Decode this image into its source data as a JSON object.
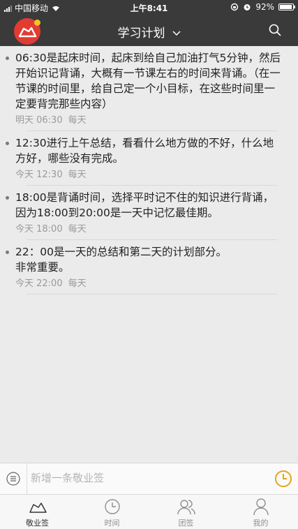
{
  "status_bar": {
    "carrier": "中国移动",
    "time": "上午8:41",
    "battery": "92%",
    "battery_level": 0.92
  },
  "header": {
    "title": "学习计划"
  },
  "plans": [
    {
      "text": "06:30是起床时间，起床到给自己加油打气5分钟，然后开始识记背诵，大概有一节课左右的时间来背诵。（在一节课的时间里，给自己定一个小目标，在这些时间里一定要背完那些内容）",
      "when": "明天 06:30",
      "repeat": "每天"
    },
    {
      "text": "12:30进行上午总结，看看什么地方做的不好，什么地方好，哪些没有完成。",
      "when": "今天 12:30",
      "repeat": "每天"
    },
    {
      "text": "18:00是背诵时间，选择平时记不住的知识进行背诵，因为18:00到20:00是一天中记忆最佳期。",
      "when": "今天 18:00",
      "repeat": "每天"
    },
    {
      "text": "22：00是一天的总结和第二天的计划部分。\n非常重要。",
      "when": "今天 22:00",
      "repeat": "每天"
    }
  ],
  "composer": {
    "placeholder": "新增一条敬业签"
  },
  "tabs": [
    {
      "label": "敬业签",
      "icon": "cloud-icon",
      "active": true
    },
    {
      "label": "时间",
      "icon": "clock-icon",
      "active": false
    },
    {
      "label": "团签",
      "icon": "group-icon",
      "active": false
    },
    {
      "label": "我的",
      "icon": "person-icon",
      "active": false
    }
  ],
  "colors": {
    "header_bg": "#3a3a3a",
    "logo_red": "#e23b32",
    "accent_yellow": "#f3c321",
    "clock_orange": "#e9a21b"
  }
}
